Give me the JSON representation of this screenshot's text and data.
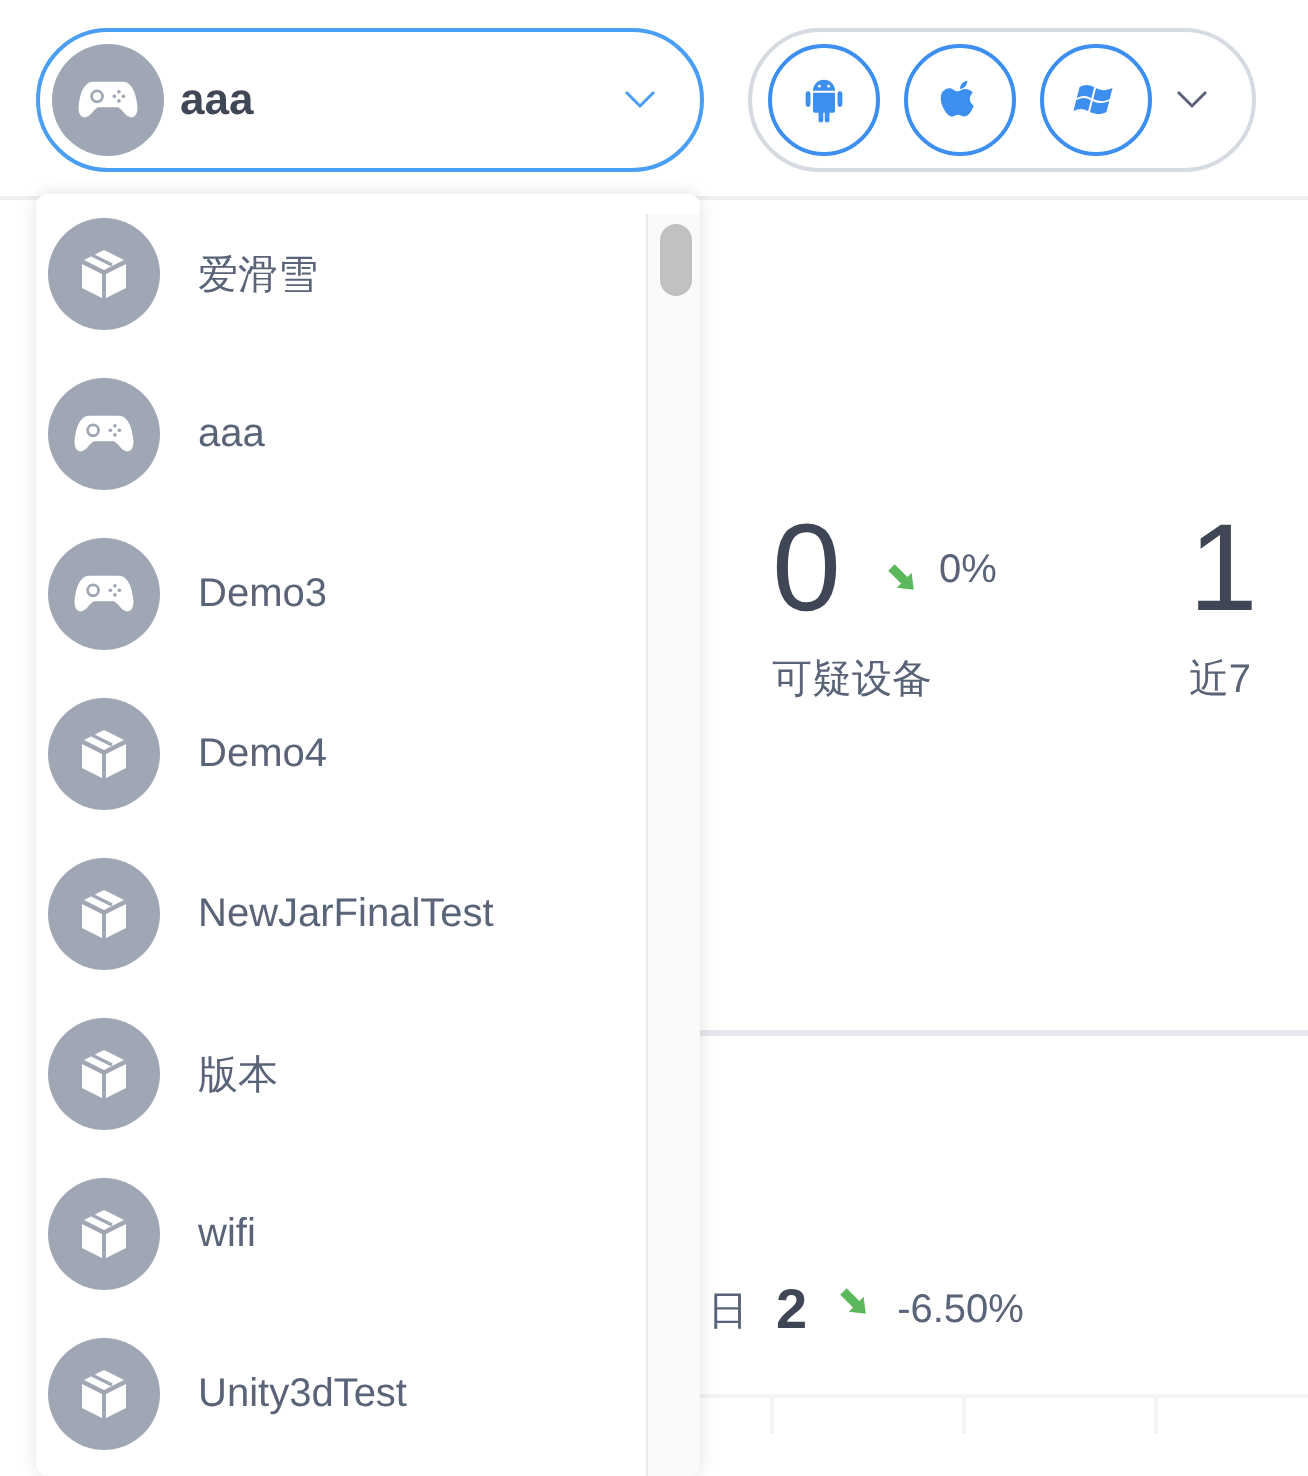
{
  "app_select": {
    "kind": "game",
    "value": "aaa"
  },
  "stats": [
    {
      "value": "0",
      "falling": true,
      "change": "0%",
      "label": "可疑设备"
    },
    {
      "value": "1",
      "label": "近7"
    }
  ],
  "today": {
    "label": "日",
    "value": "2",
    "falling": true,
    "change": "-6.50%"
  },
  "dropdown": {
    "items": [
      {
        "kind": "app",
        "label": "爱滑雪"
      },
      {
        "kind": "game",
        "label": "aaa"
      },
      {
        "kind": "game",
        "label": "Demo3"
      },
      {
        "kind": "app",
        "label": "Demo4"
      },
      {
        "kind": "app",
        "label": "NewJarFinalTest"
      },
      {
        "kind": "app",
        "label": "版本"
      },
      {
        "kind": "app",
        "label": "wifi"
      },
      {
        "kind": "app",
        "label": "Unity3dTest"
      }
    ]
  }
}
